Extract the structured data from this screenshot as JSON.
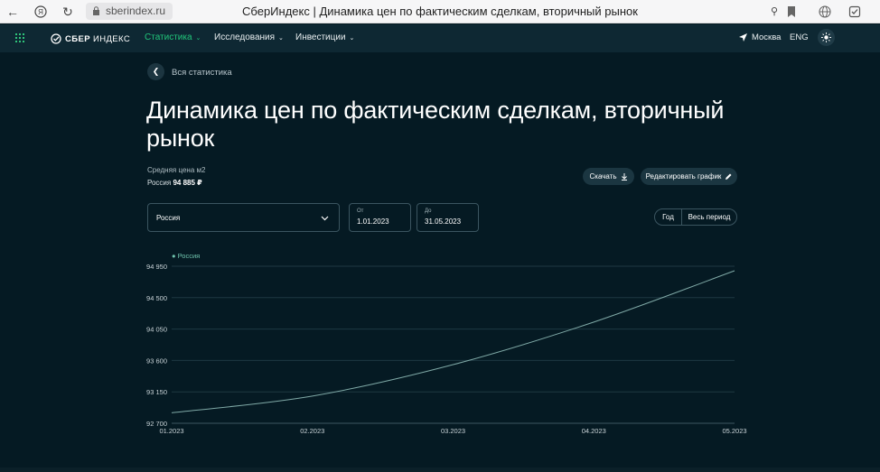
{
  "browser": {
    "url": "sberindex.ru",
    "title": "СберИндекс | Динамика цен по фактическим сделкам, вторичный рынок"
  },
  "header": {
    "logo_bold": "СБЕР",
    "logo_light": "ИНДЕКС",
    "nav": [
      {
        "label": "Статистика",
        "active": true
      },
      {
        "label": "Исследования",
        "active": false
      },
      {
        "label": "Инвестиции",
        "active": false
      }
    ],
    "city": "Москва",
    "lang": "ENG"
  },
  "page": {
    "back_label": "Вся статистика",
    "title": "Динамика цен по фактическим сделкам, вторичный рынок",
    "metric_label": "Средняя цена м2",
    "metric_region": "Россия",
    "metric_value": "94 885 ₽",
    "download_label": "Скачать",
    "edit_label": "Редактировать график"
  },
  "filters": {
    "region": "Россия",
    "from_label": "От",
    "from_value": "1.01.2023",
    "to_label": "До",
    "to_value": "31.05.2023",
    "period_year": "Год",
    "period_all": "Весь период"
  },
  "colors": {
    "background": "#051a23",
    "accent": "#21c77b",
    "line": "#7fa9a6"
  },
  "chart_data": {
    "type": "line",
    "legend": [
      "Россия"
    ],
    "x": [
      "01.2023",
      "02.2023",
      "03.2023",
      "04.2023",
      "05.2023"
    ],
    "series": [
      {
        "name": "Россия",
        "values": [
          92850,
          93090,
          93540,
          94150,
          94885
        ]
      }
    ],
    "y_ticks": [
      92700,
      93150,
      93600,
      94050,
      94500,
      94950
    ],
    "y_tick_labels": [
      "92 700",
      "93 150",
      "93 600",
      "94 050",
      "94 500",
      "94 950"
    ],
    "ylim": [
      92700,
      94950
    ],
    "grid": true,
    "legend_position": "top-left"
  }
}
